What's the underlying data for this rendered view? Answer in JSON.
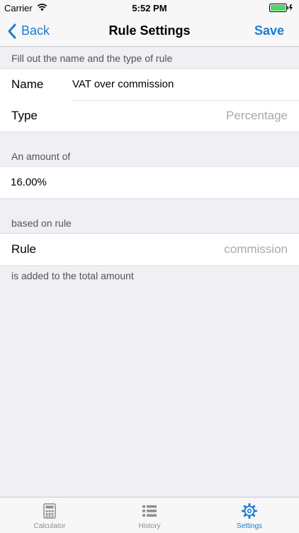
{
  "status_bar": {
    "carrier": "Carrier",
    "time": "5:52 PM",
    "battery_color": "#4cd964"
  },
  "nav": {
    "back_label": "Back",
    "title": "Rule Settings",
    "save_label": "Save",
    "accent_color": "#1a7bd6"
  },
  "sections": {
    "name_type_header": "Fill out the name and the type of rule",
    "name_label": "Name",
    "name_value": "VAT over commission",
    "type_label": "Type",
    "type_value": "Percentage",
    "amount_header": "An amount of",
    "amount_value": "16.00%",
    "based_on_header": "based on rule",
    "rule_label": "Rule",
    "rule_value": "commission",
    "footer_note": "is added to the total amount"
  },
  "tab_bar": {
    "tabs": [
      {
        "label": "Calculator",
        "icon": "calculator-icon",
        "active": false
      },
      {
        "label": "History",
        "icon": "list-icon",
        "active": false
      },
      {
        "label": "Settings",
        "icon": "gear-icon",
        "active": true
      }
    ]
  }
}
